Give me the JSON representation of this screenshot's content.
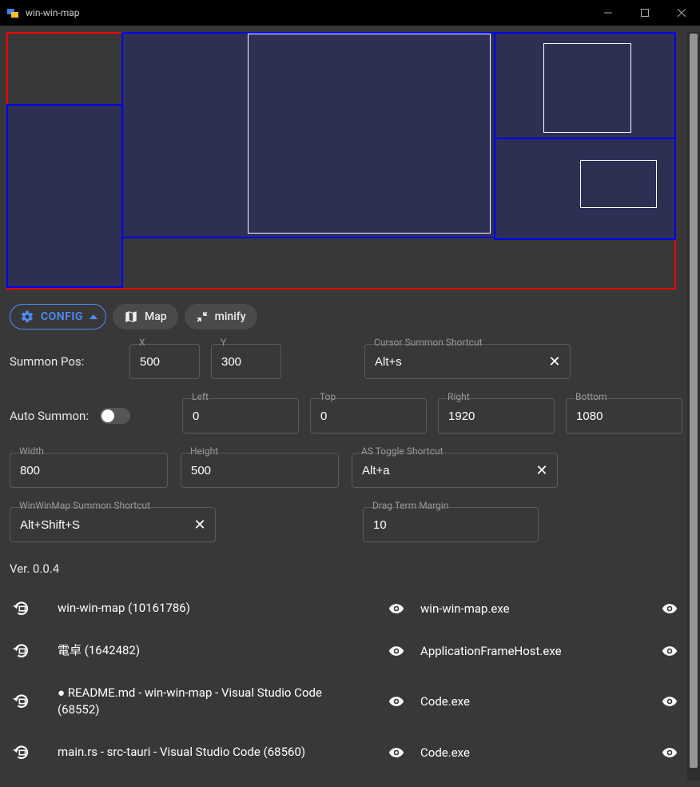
{
  "window": {
    "title": "win-win-map",
    "titlebar": {
      "minimize": "—",
      "maximize": "☐",
      "close": "✕"
    }
  },
  "toolbar": {
    "config_label": "CONFIG",
    "map_label": "Map",
    "minify_label": "minify"
  },
  "form": {
    "summon_pos_label": "Summon Pos:",
    "x_label": "X",
    "x_value": "500",
    "y_label": "Y",
    "y_value": "300",
    "cursor_shortcut_label": "Cursor Summon Shortcut",
    "cursor_shortcut_value": "Alt+s",
    "auto_summon_label": "Auto Summon:",
    "auto_summon_on": false,
    "left_label": "Left",
    "left_value": "0",
    "top_label": "Top",
    "top_value": "0",
    "right_label": "Right",
    "right_value": "1920",
    "bottom_label": "Bottom",
    "bottom_value": "1080",
    "width_label": "Width",
    "width_value": "800",
    "height_label": "Height",
    "height_value": "500",
    "as_toggle_label": "AS Toggle Shortcut",
    "as_toggle_value": "Alt+a",
    "wwm_shortcut_label": "WinWinMap Summon Shortcut",
    "wwm_shortcut_value": "Alt+Shift+S",
    "drag_margin_label": "Drag Term Margin",
    "drag_margin_value": "10"
  },
  "version_label": "Ver. 0.0.4",
  "windows": [
    {
      "title": "win-win-map (10161786)",
      "exe": "win-win-map.exe"
    },
    {
      "title": "電卓 (1642482)",
      "exe": "ApplicationFrameHost.exe"
    },
    {
      "title": "● README.md - win-win-map - Visual Studio Code (68552)",
      "exe": "Code.exe"
    },
    {
      "title": "main.rs - src-tauri - Visual Studio Code (68560)",
      "exe": "Code.exe"
    }
  ]
}
